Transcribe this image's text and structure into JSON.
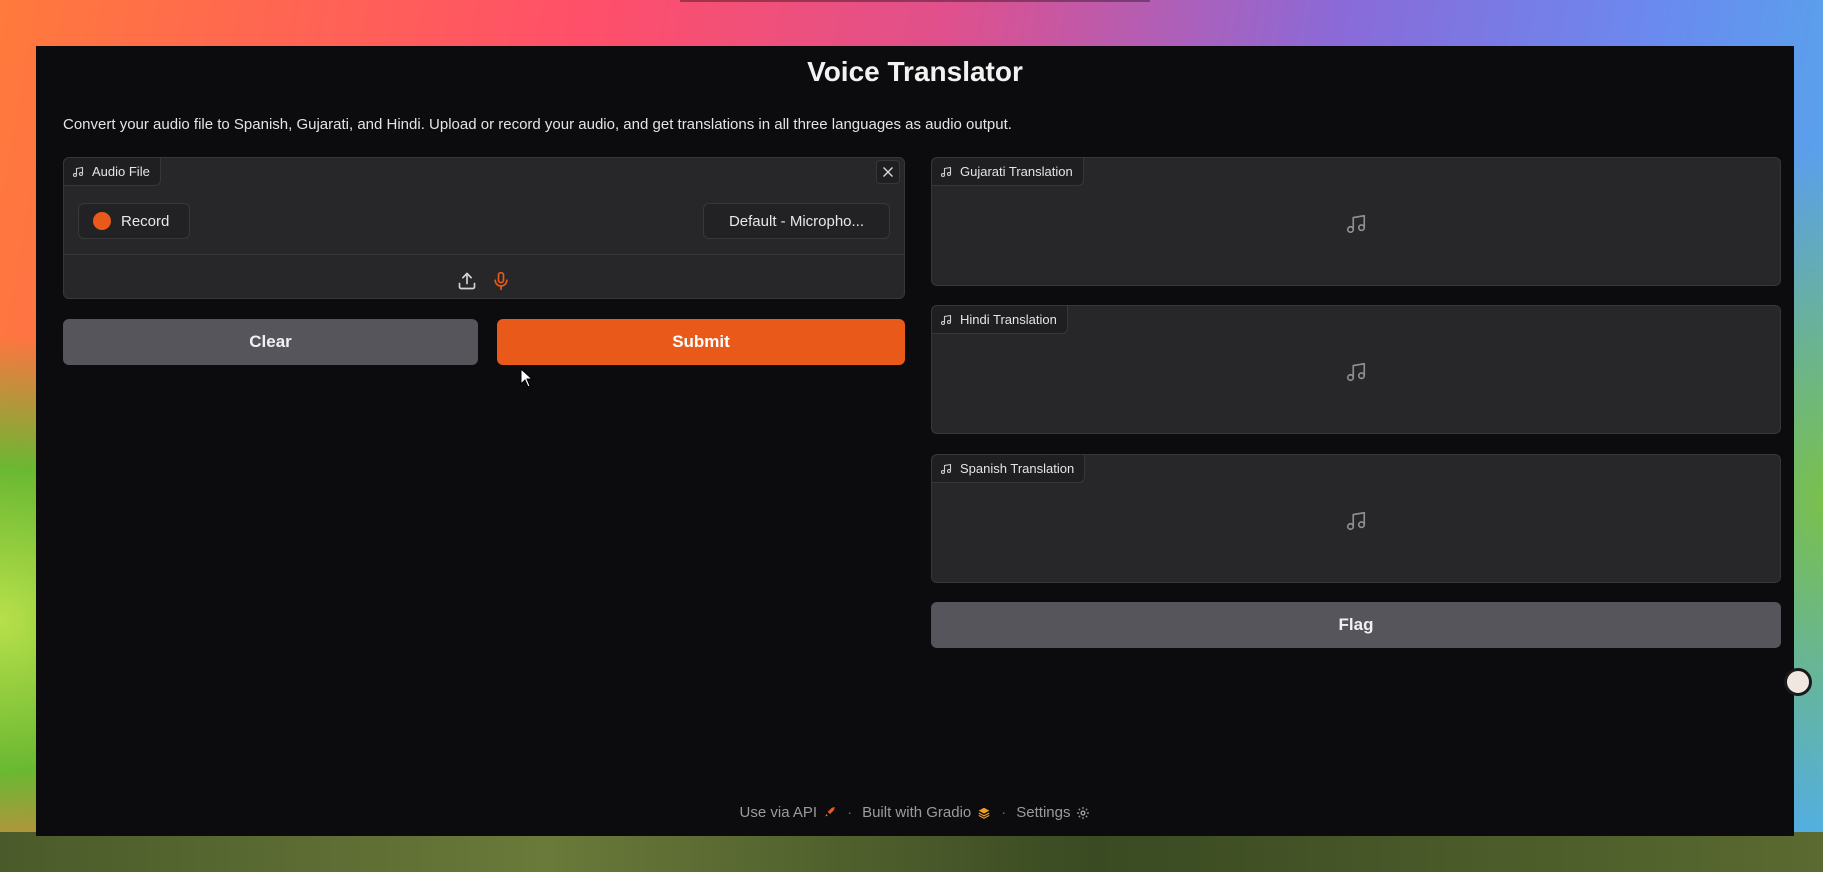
{
  "app": {
    "title": "Voice Translator",
    "description": "Convert your audio file to Spanish, Gujarati, and Hindi. Upload or record your audio, and get translations in all three languages as audio output."
  },
  "input_panel": {
    "label": "Audio File",
    "record_label": "Record",
    "device_label": "Default - Micropho..."
  },
  "buttons": {
    "clear": "Clear",
    "submit": "Submit",
    "flag": "Flag"
  },
  "outputs": [
    {
      "label": "Gujarati Translation"
    },
    {
      "label": "Hindi Translation"
    },
    {
      "label": "Spanish Translation"
    }
  ],
  "footer": {
    "api": "Use via API",
    "built": "Built with Gradio",
    "settings": "Settings",
    "separator": "·"
  },
  "colors": {
    "accent": "#e8591a",
    "background": "#0c0c0e",
    "panel": "#27272a",
    "secondary_button": "#55555b"
  },
  "icons": [
    "music-note-icon",
    "close-icon",
    "upload-icon",
    "microphone-icon",
    "rocket-icon",
    "gradio-logo-icon",
    "gear-icon"
  ]
}
